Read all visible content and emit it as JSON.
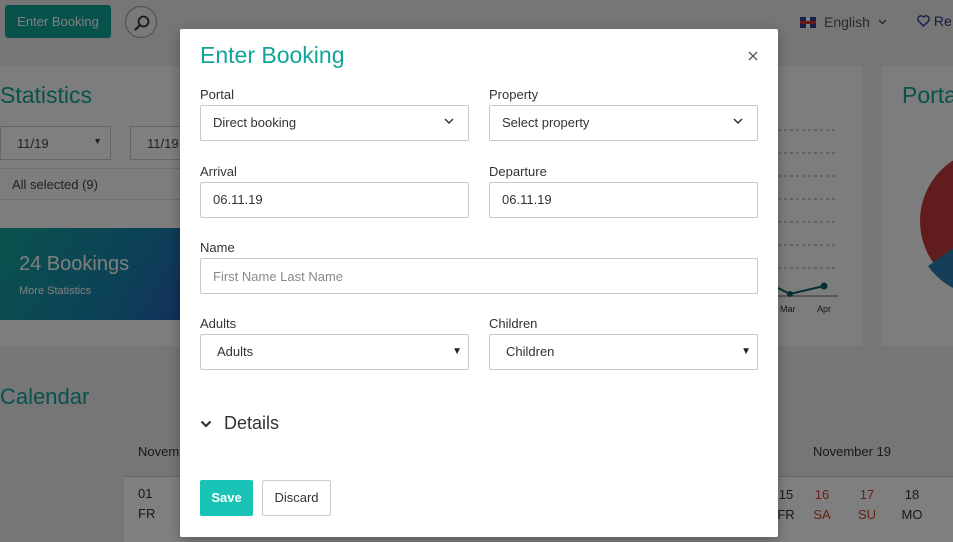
{
  "background": {
    "enter_booking_label": "Enter Booking",
    "search_icon": "search-icon",
    "language": "English",
    "fav_label": "Re",
    "statistics_title": "Statistics",
    "date_from": "11/19",
    "date_to": "11/19",
    "all_selected": "All selected (9)",
    "bookings_count": "24 Bookings",
    "bookings_link": "More Statistics",
    "chart_labels": [
      "Mar",
      "Apr"
    ],
    "portal_title": "Porta",
    "calendar_title": "Calendar",
    "month_left": "Novem",
    "month_right": "November 19",
    "first_day_num": "01",
    "first_day_name": "FR",
    "days": [
      {
        "num": "15",
        "name": "FR",
        "weekend": false
      },
      {
        "num": "16",
        "name": "SA",
        "weekend": true
      },
      {
        "num": "17",
        "name": "SU",
        "weekend": true
      },
      {
        "num": "18",
        "name": "MO",
        "weekend": false
      }
    ]
  },
  "modal": {
    "title": "Enter Booking",
    "close_icon": "close-icon",
    "portal_label": "Portal",
    "portal_value": "Direct booking",
    "property_label": "Property",
    "property_value": "Select property",
    "arrival_label": "Arrival",
    "arrival_value": "06.11.19",
    "departure_label": "Departure",
    "departure_value": "06.11.19",
    "name_label": "Name",
    "name_placeholder": "First Name Last Name",
    "adults_label": "Adults",
    "adults_value": "Adults",
    "children_label": "Children",
    "children_value": "Children",
    "details_label": "Details",
    "save_label": "Save",
    "discard_label": "Discard"
  },
  "colors": {
    "accent": "#11a599",
    "save_button": "#19c3b6"
  }
}
